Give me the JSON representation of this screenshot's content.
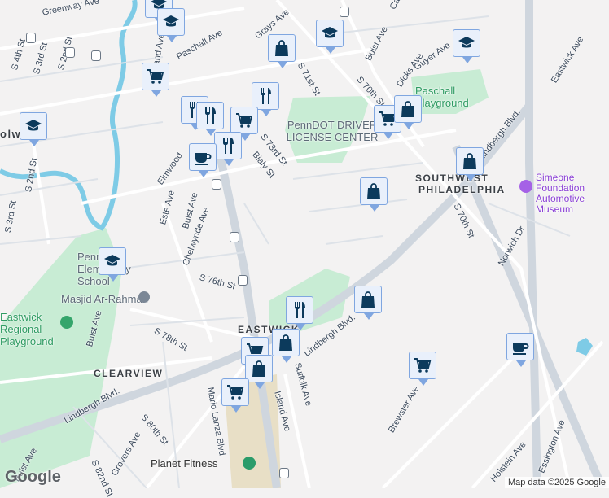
{
  "map": {
    "street_labels": [
      "Greenway Ave",
      "S 4th St",
      "S 3rd St",
      "S 2nd St",
      "Paschall Ave",
      "Island Ave",
      "Grays Ave",
      "S 71st St",
      "Buist Ave",
      "Carroll St",
      "Dicks Ave",
      "Guyer Ave",
      "S 70th St",
      "Eastwick Ave",
      "Lindbergh Blvd.",
      "S 73rd St",
      "Bialy St",
      "Elmwood",
      "Este Ave",
      "Buist Ave",
      "Chelwynde Ave",
      "S 2nd St",
      "S 3rd St",
      "S 76th St",
      "S 78th St",
      "Buist Ave",
      "Norwich Dr",
      "Suffolk Ave",
      "Lindbergh Blvd.",
      "Mario Lanza Blvd",
      "Island Ave",
      "S 80th St",
      "Grovers Ave",
      "S 82nd St",
      "Buist Ave",
      "Lindbergh Blvd.",
      "Brewster Ave",
      "Holstein Ave",
      "Essington Ave",
      "S 70th St"
    ],
    "area_labels": [
      "SOUTHWEST",
      "PHILADELPHIA",
      "EASTWICK",
      "CLEARVIEW",
      "olwyn"
    ],
    "poi_labels": {
      "penndot": "PennDOT DRIVER LICENSE CENTER",
      "paschall_playground": "Paschall Playground",
      "simeone": "Simeone Foundation Automotive Museum",
      "penn_elementary": "Penn Elementary School",
      "masjid": "Masjid Ar-Rahman",
      "regional_playground": "Eastwick Regional Playground",
      "planet_fitness": "Planet Fitness"
    },
    "markers": [
      "school",
      "school",
      "shopping-bag",
      "school",
      "school",
      "shopping-cart",
      "restaurant",
      "restaurant",
      "restaurant",
      "shopping-cart",
      "restaurant",
      "coffee",
      "school",
      "shopping-cart",
      "shopping-bag",
      "shopping-bag",
      "shopping-bag",
      "school",
      "restaurant",
      "shopping-bag",
      "shopping-bag",
      "shopping-cart",
      "shopping-bag",
      "shopping-cart",
      "shopping-cart",
      "coffee"
    ],
    "colors": {
      "background": "#f3f2f2",
      "park": "#c8ecd4",
      "road": "#ffffff",
      "highway": "#cfd6de",
      "marker_fill": "#e9f0fb",
      "marker_border": "#7fa6e0",
      "icon": "#0c3a5c",
      "water": "#7ecbe6"
    }
  },
  "footer": {
    "logo": "Google",
    "attribution": "Map data ©2025 Google"
  }
}
